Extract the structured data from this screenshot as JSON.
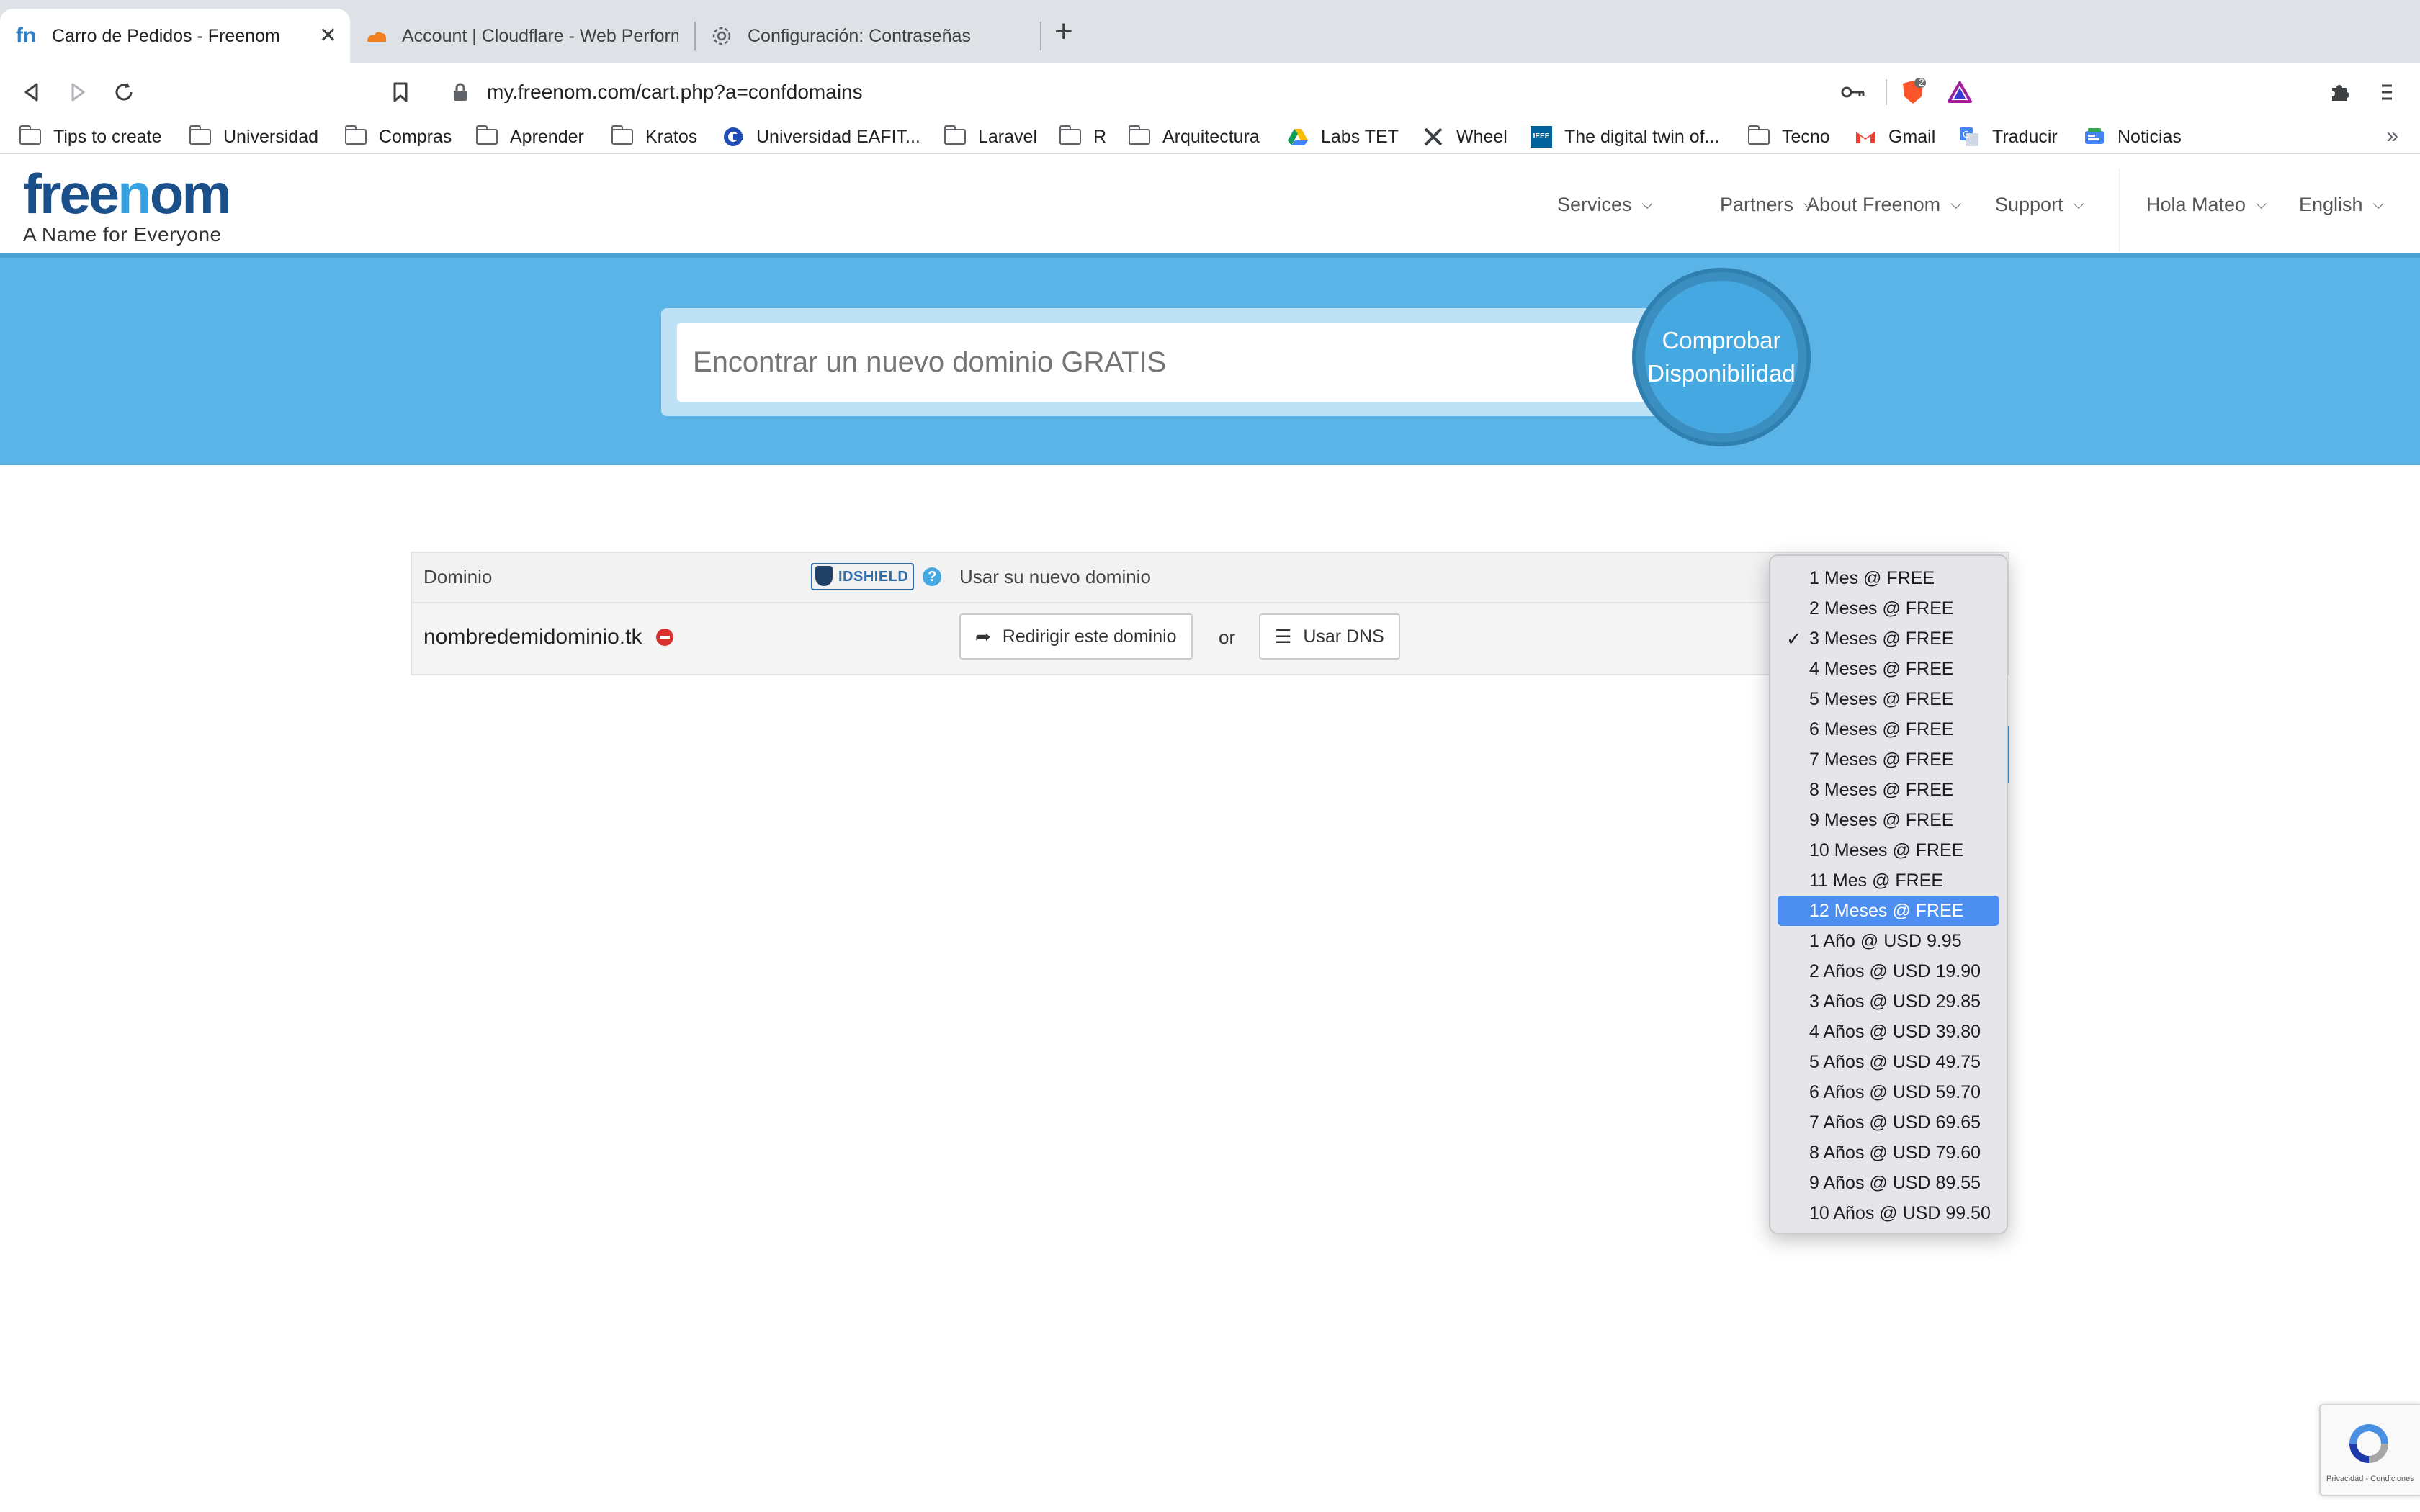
{
  "browser": {
    "tabs": [
      {
        "title": "Carro de Pedidos - Freenom",
        "active": true,
        "icon": "freenom-icon"
      },
      {
        "title": "Account | Cloudflare - Web Perform",
        "active": false,
        "icon": "cloudflare-icon"
      },
      {
        "title": "Configuración: Contraseñas",
        "active": false,
        "icon": "gear-icon"
      }
    ],
    "new_tab": "+",
    "url": "my.freenom.com/cart.php?a=confdomains",
    "brave_shield_count": "2",
    "bookmarks": [
      {
        "label": "Tips to create",
        "icon": "folder-icon"
      },
      {
        "label": "Universidad",
        "icon": "folder-icon"
      },
      {
        "label": "Compras",
        "icon": "folder-icon"
      },
      {
        "label": "Aprender",
        "icon": "folder-icon"
      },
      {
        "label": "Kratos",
        "icon": "folder-icon"
      },
      {
        "label": "Universidad EAFIT...",
        "icon": "eafit-icon"
      },
      {
        "label": "Laravel",
        "icon": "folder-icon"
      },
      {
        "label": "R",
        "icon": "folder-icon"
      },
      {
        "label": "Arquitectura",
        "icon": "folder-icon"
      },
      {
        "label": "Labs TET",
        "icon": "drive-icon"
      },
      {
        "label": "Wheel",
        "icon": "tools-icon"
      },
      {
        "label": "The digital twin of...",
        "icon": "ieee-icon"
      },
      {
        "label": "Tecno",
        "icon": "folder-icon"
      },
      {
        "label": "Gmail",
        "icon": "gmail-icon"
      },
      {
        "label": "Traducir",
        "icon": "translate-icon"
      },
      {
        "label": "Noticias",
        "icon": "news-icon"
      }
    ],
    "bookmarks_more": "»"
  },
  "site": {
    "logo_text": "freenom",
    "tagline": "A Name for Everyone",
    "menu": [
      "Services",
      "Partners",
      "About Freenom",
      "Support"
    ],
    "user_menu": "Hola Mateo",
    "language": "English",
    "search_placeholder": "Encontrar un nuevo dominio GRATIS",
    "check_button": [
      "Comprobar",
      "Disponibilidad"
    ]
  },
  "domain_table": {
    "col_domain": "Dominio",
    "idshield_label": "IDSHIELD",
    "col_use": "Usar su nuevo dominio",
    "domain_name": "nombredemidominio.tk",
    "redirect_button": "Redirigir este dominio",
    "or": "or",
    "dns_button": "Usar DNS"
  },
  "period_dropdown": {
    "checked": "3 Meses @ FREE",
    "highlighted": "12 Meses @ FREE",
    "options": [
      "1 Mes @ FREE",
      "2 Meses @ FREE",
      "3 Meses @ FREE",
      "4 Meses @ FREE",
      "5 Meses @ FREE",
      "6 Meses @ FREE",
      "7 Meses @ FREE",
      "8 Meses @ FREE",
      "9 Meses @ FREE",
      "10 Meses @ FREE",
      "11 Mes @ FREE",
      "12 Meses @ FREE",
      "1 Año @ USD 9.95",
      "2 Años @ USD 19.90",
      "3 Años @ USD 29.85",
      "4 Años @ USD 39.80",
      "5 Años @ USD 49.75",
      "6 Años @ USD 59.70",
      "7 Años @ USD 69.65",
      "8 Años @ USD 79.60",
      "9 Años @ USD 89.55",
      "10 Años @ USD 99.50"
    ]
  },
  "recaptcha": {
    "footer": "Privacidad - Condiciones"
  },
  "colors": {
    "hero": "#5bb4e8",
    "accent": "#45a8e0",
    "selected": "#4d8ff0",
    "logo_dark": "#1b4f8a"
  }
}
